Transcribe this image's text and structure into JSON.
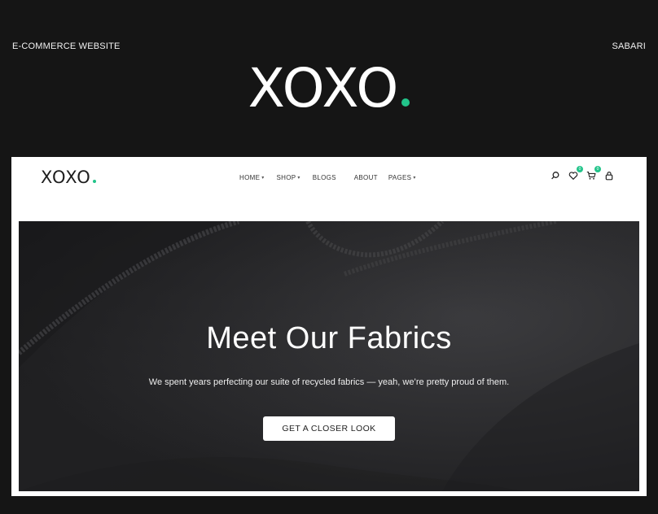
{
  "header": {
    "left_label": "E-COMMERCE WEBSITE",
    "right_label": "SABARI",
    "brand": "XOXO"
  },
  "site": {
    "logo": "XOXO",
    "nav": [
      {
        "label": "HOME",
        "has_dropdown": true
      },
      {
        "label": "SHOP",
        "has_dropdown": true
      },
      {
        "label": "BLOGS",
        "has_dropdown": false
      },
      {
        "label": "ABOUT",
        "has_dropdown": false
      },
      {
        "label": "PAGES",
        "has_dropdown": true
      }
    ],
    "icons": [
      {
        "name": "search-icon"
      },
      {
        "name": "heart-icon",
        "badge": "0"
      },
      {
        "name": "cart-icon",
        "badge": "0"
      },
      {
        "name": "lock-icon"
      }
    ]
  },
  "hero": {
    "title": "Meet Our Fabrics",
    "subtitle": "We spent years perfecting our suite of recycled fabrics — yeah, we’re pretty proud of them.",
    "cta": "GET A CLOSER LOOK"
  },
  "colors": {
    "page_bg": "#151515",
    "accent": "#22c48a",
    "hero_bg": "#2a2a2c"
  }
}
